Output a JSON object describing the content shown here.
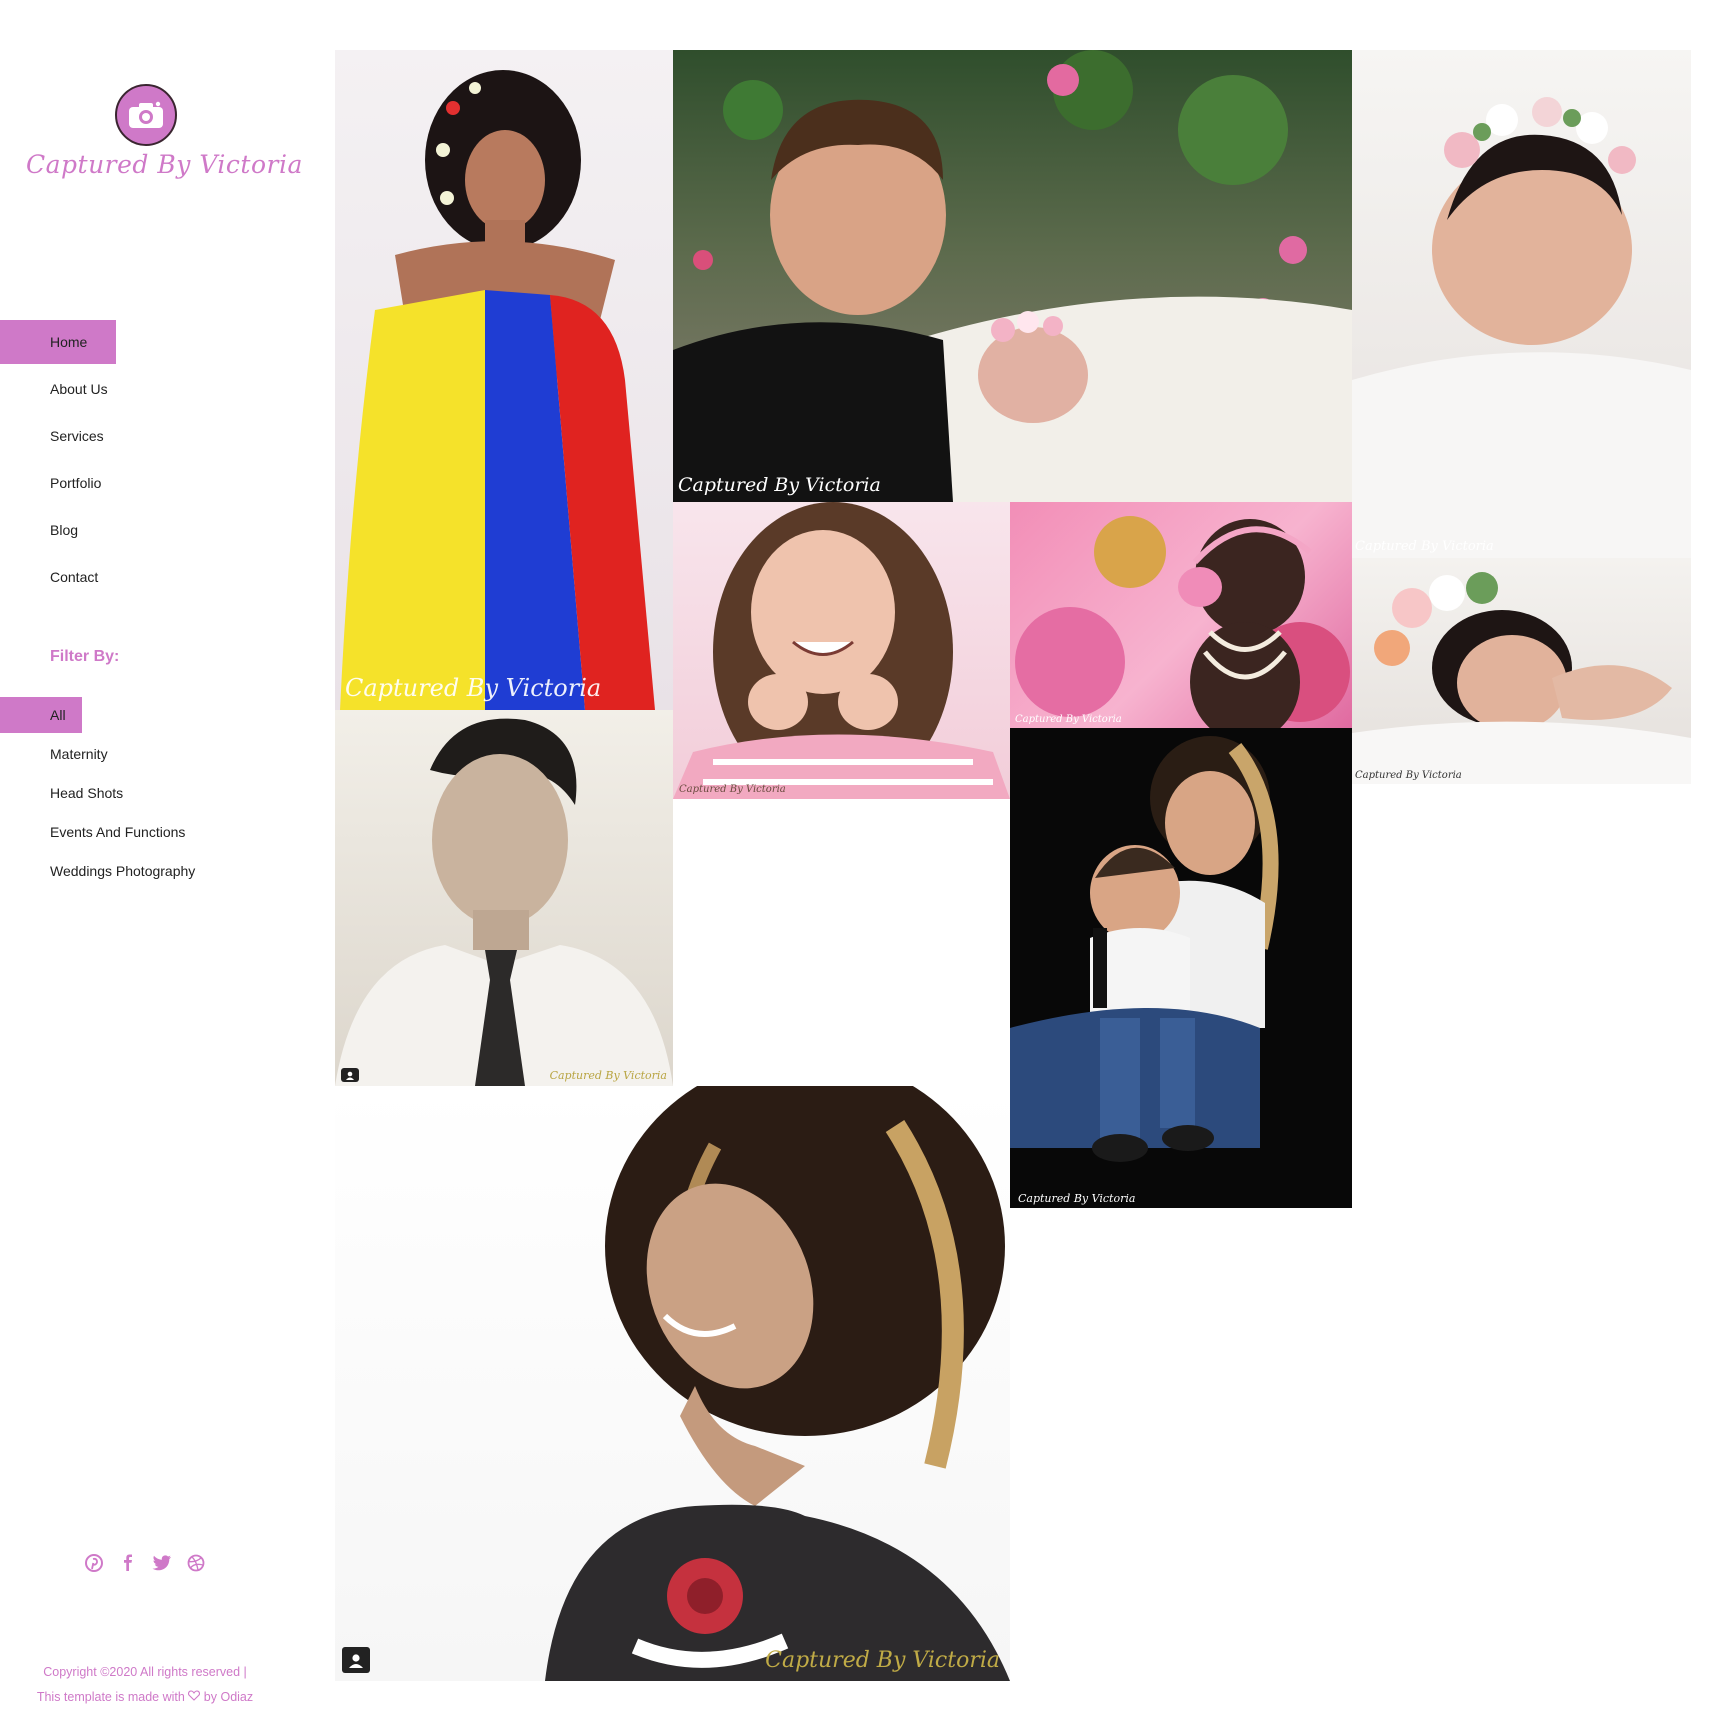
{
  "brand": {
    "name": "Captured By  Victoria",
    "accent_color": "#cf79c8",
    "logo_icon": "camera-icon"
  },
  "nav": {
    "items": [
      {
        "label": "Home",
        "active": true
      },
      {
        "label": "About Us",
        "active": false
      },
      {
        "label": "Services",
        "active": false
      },
      {
        "label": "Portfolio",
        "active": false
      },
      {
        "label": "Blog",
        "active": false
      },
      {
        "label": "Contact",
        "active": false
      }
    ]
  },
  "filter": {
    "title": "Filter By:",
    "items": [
      {
        "label": "All",
        "active": true
      },
      {
        "label": "Maternity",
        "active": false
      },
      {
        "label": "Head Shots",
        "active": false
      },
      {
        "label": "Events And Functions",
        "active": false
      },
      {
        "label": "Weddings Photography",
        "active": false
      }
    ]
  },
  "social": [
    "pinterest-icon",
    "facebook-icon",
    "twitter-icon",
    "dribbble-icon"
  ],
  "footer": {
    "line1": "Copyright ©2020 All rights reserved |",
    "line2_prefix": "This template is made with",
    "line2_suffix": "by Odiaz"
  },
  "gallery": {
    "watermark": "Captured By Victoria",
    "photos": [
      {
        "name": "maternity-flag-photo"
      },
      {
        "name": "boy-and-newborn-photo"
      },
      {
        "name": "newborn-flower-crown-photo"
      },
      {
        "name": "smiling-girl-photo"
      },
      {
        "name": "cake-smash-baby-photo"
      },
      {
        "name": "newborn-sleeping-photo"
      },
      {
        "name": "headshot-tie-photo"
      },
      {
        "name": "mother-and-baby-photo"
      },
      {
        "name": "curly-hair-portrait-photo"
      }
    ]
  }
}
